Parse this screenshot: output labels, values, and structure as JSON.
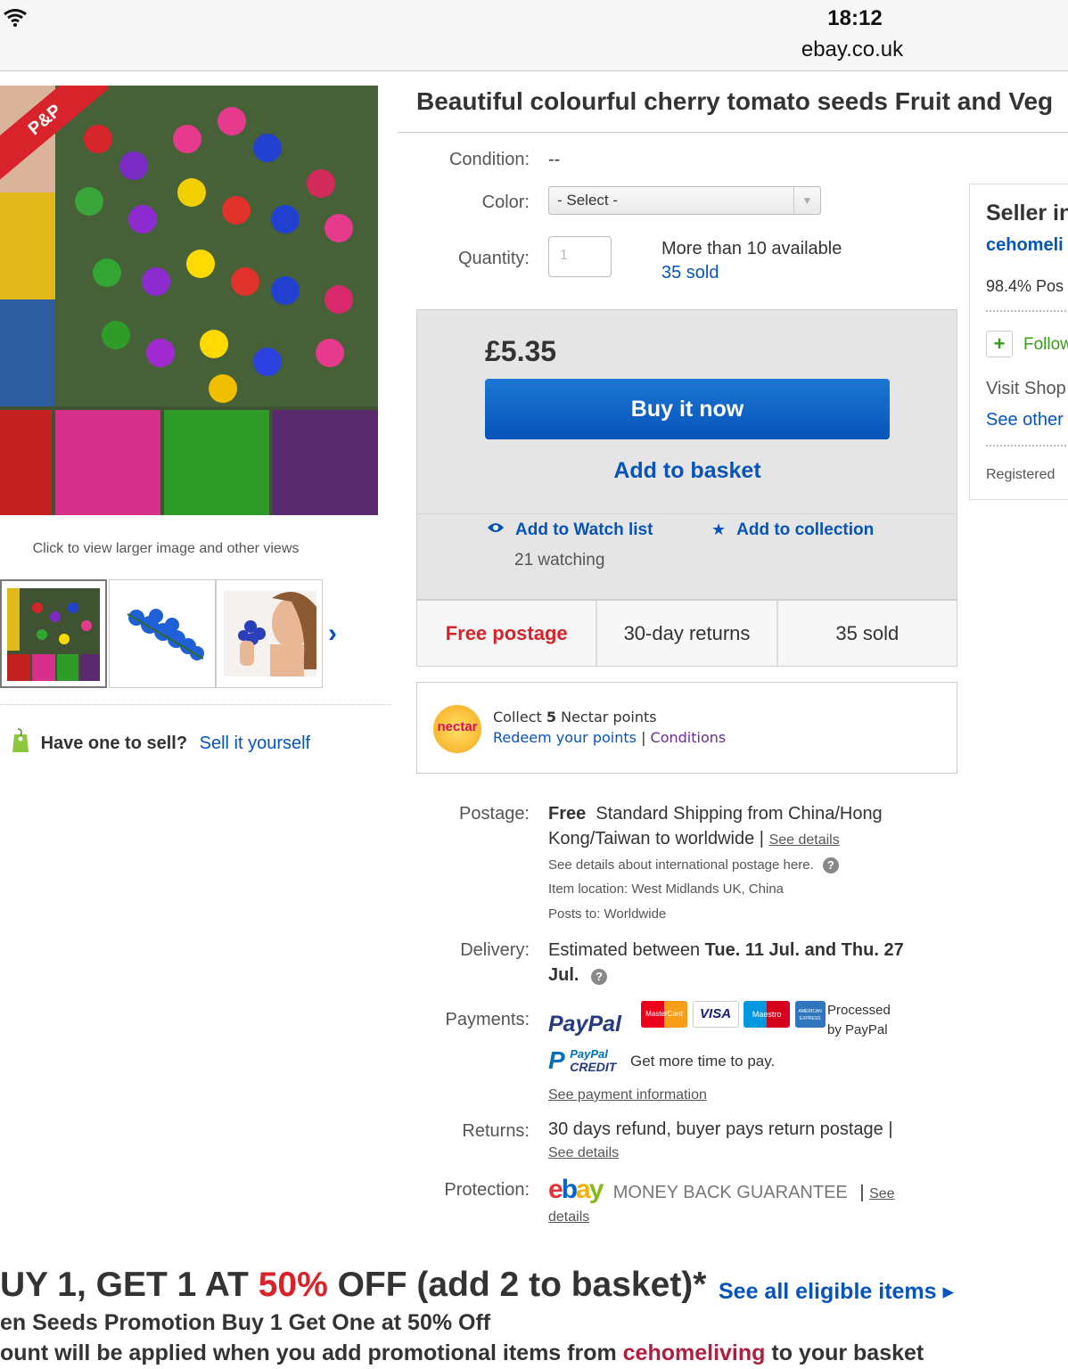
{
  "status_bar": {
    "time": "18:12",
    "domain": "ebay.co.uk"
  },
  "gallery": {
    "ribbon": "P&P",
    "caption": "Click to view larger image and other views",
    "next_arrow": "›"
  },
  "sell": {
    "question": "Have one to sell?",
    "link": "Sell it yourself"
  },
  "item": {
    "title": "Beautiful colourful cherry tomato seeds Fruit and Veg",
    "condition_label": "Condition:",
    "condition_value": "--",
    "color_label": "Color:",
    "color_value": "- Select -",
    "quantity_label": "Quantity:",
    "quantity_placeholder": "1",
    "availability": "More than 10 available",
    "sold": "35 sold"
  },
  "buy": {
    "price": "£5.35",
    "buy_now": "Buy it now",
    "add_basket": "Add to basket",
    "watch": "Add to Watch list",
    "collection": "Add to collection",
    "watching": "21 watching"
  },
  "perks": [
    "Free postage",
    "30-day returns",
    "35 sold"
  ],
  "nectar": {
    "logo": "nectar",
    "collect_prefix": "Collect",
    "points": "5",
    "collect_suffix": "Nectar points",
    "redeem": "Redeem your points",
    "sep": "|",
    "conditions": "Conditions"
  },
  "postage": {
    "label": "Postage:",
    "free": "Free",
    "line1": "Standard Shipping from China/Hong",
    "line2": "Kong/Taiwan to worldwide",
    "see_details": "See details",
    "intl": "See details about international postage here.",
    "location": "Item location:  West Midlands UK, China",
    "posts_to": "Posts to:  Worldwide"
  },
  "delivery": {
    "label": "Delivery:",
    "prefix": "Estimated between",
    "dates1": "Tue. 11 Jul. and Thu. 27",
    "dates2": "Jul."
  },
  "payments": {
    "label": "Payments:",
    "paypal": "PayPal",
    "cards": [
      "MasterCard",
      "VISA",
      "Maestro",
      "AMERICAN EXPRESS"
    ],
    "processed": "Processed",
    "by_paypal": "by PayPal",
    "credit_line1": "PayPal",
    "credit_line2": "CREDIT",
    "credit_text": "Get more time to pay.",
    "info_link": "See payment information"
  },
  "returns": {
    "label": "Returns:",
    "text": "30 days refund, buyer pays return postage |",
    "link": "See details"
  },
  "protection": {
    "label": "Protection:",
    "logo": "ebay",
    "text": "MONEY BACK GUARANTEE",
    "see": "See",
    "details": "details"
  },
  "seller": {
    "heading": "Seller in",
    "name": "cehomeli",
    "feedback": "98.4% Pos",
    "follow": "Follow",
    "visit": "Visit Shop",
    "see_other": "See other",
    "registered": "Registered"
  },
  "promo": {
    "head_a": "UY 1, GET 1 AT ",
    "head_pct": "50%",
    "head_b": " OFF (add 2 to basket)*",
    "link": "See all eligible items ▸",
    "line2": "en Seeds Promotion Buy 1 Get One at 50% Off",
    "line3_a": "ount will be applied when you add promotional items from ",
    "line3_seller": "cehomeliving",
    "line3_b": " to your basket"
  },
  "colors": {
    "ebay_blue": "#0654ba",
    "free_red": "#d8232a"
  }
}
